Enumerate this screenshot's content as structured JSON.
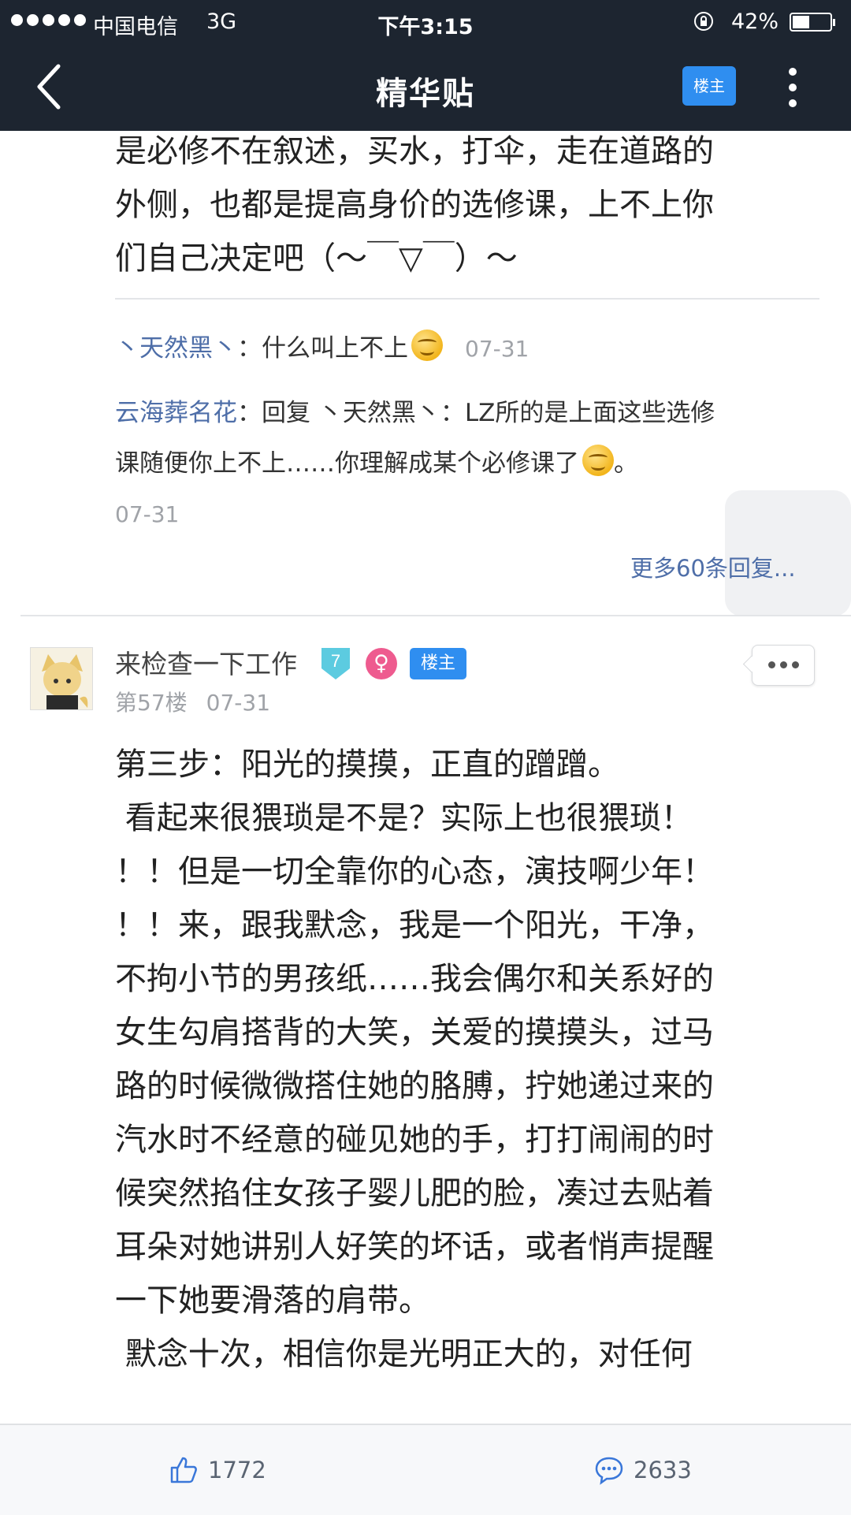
{
  "status": {
    "carrier": "中国电信",
    "network": "3G",
    "time": "下午3:15",
    "battery": "42%"
  },
  "nav": {
    "title": "精华贴",
    "lz_button": "楼主"
  },
  "previous_post": {
    "text_lines": [
      "是必修不在叙述，买水，打伞，走在道路的",
      "外侧，也都是提高身价的选修课，上不上你",
      "们自己决定吧（～￣▽￣）～"
    ],
    "replies": [
      {
        "name": "丶天然黑丶",
        "sep": "：",
        "text": "什么叫上不上",
        "date": "07-31"
      },
      {
        "name": "云海葬名花",
        "sep": "：",
        "text_a": "回复 丶天然黑丶：LZ所的是上面这些选修",
        "text_b": "课随便你上不上……你理解成某个必修课了",
        "text_c": "。",
        "date": "07-31"
      }
    ],
    "more_replies": "更多60条回复..."
  },
  "post": {
    "author": "来检查一下工作",
    "level": "7",
    "gender_symbol": "♀",
    "lz_tag": "楼主",
    "floor": "第57楼",
    "date": "07-31",
    "text_lines": [
      "第三步：阳光的摸摸，正直的蹭蹭。",
      " 看起来很猥琐是不是？实际上也很猥琐！",
      "！！但是一切全靠你的心态，演技啊少年！",
      "！！来，跟我默念，我是一个阳光，干净，",
      "不拘小节的男孩纸……我会偶尔和关系好的",
      "女生勾肩搭背的大笑，关爱的摸摸头，过马",
      "路的时候微微搭住她的胳膊，拧她递过来的",
      "汽水时不经意的碰见她的手，打打闹闹的时",
      "候突然掐住女孩子婴儿肥的脸，凑过去贴着",
      "耳朵对她讲别人好笑的坏话，或者悄声提醒",
      "一下她要滑落的肩带。",
      " 默念十次，相信你是光明正大的，对任何"
    ]
  },
  "bottom": {
    "likes": "1772",
    "comments": "2633"
  },
  "icons": {
    "back": "chevron-left-icon",
    "more": "vertical-dots-icon",
    "like": "thumbs-up-icon",
    "comment": "comment-bubble-icon",
    "emoji": "smile-emoji-icon"
  },
  "colors": {
    "nav_bg": "#1d2530",
    "accent_blue": "#2f8ef0",
    "name_blue": "#4e6ea8",
    "female_pink": "#ee5b8f",
    "level_cyan": "#5ccbe0"
  }
}
